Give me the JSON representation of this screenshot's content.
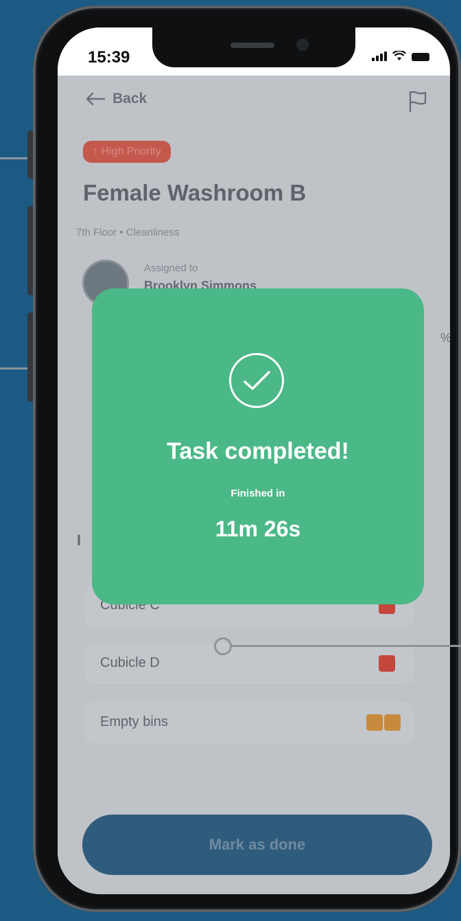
{
  "status_bar": {
    "time": "15:39"
  },
  "header": {
    "back_label": "Back",
    "flag_icon": "flag-icon"
  },
  "task": {
    "priority_label": "↑ High Priority",
    "title": "Female Washroom B",
    "meta": "7th Floor  •  Cleanliness",
    "assigned_label": "Assigned to",
    "assigned_name": "Brooklyn Simmons",
    "progress_label": "%",
    "section_initial": "I"
  },
  "checklist": [
    {
      "label": "Cubicle C",
      "color": "#c4463c"
    },
    {
      "label": "Cubicle D",
      "color": "#c4463c"
    },
    {
      "label": "Empty bins",
      "color": "#c78a3c"
    }
  ],
  "action": {
    "mark_done_label": "Mark as done"
  },
  "modal": {
    "title": "Task completed!",
    "subtitle": "Finished in",
    "duration": "11m 26s",
    "icon": "check-circle-icon"
  },
  "colors": {
    "accent_green": "#4bb887",
    "backdrop_blue": "#1c5a84",
    "priority_red": "#c4584d"
  }
}
